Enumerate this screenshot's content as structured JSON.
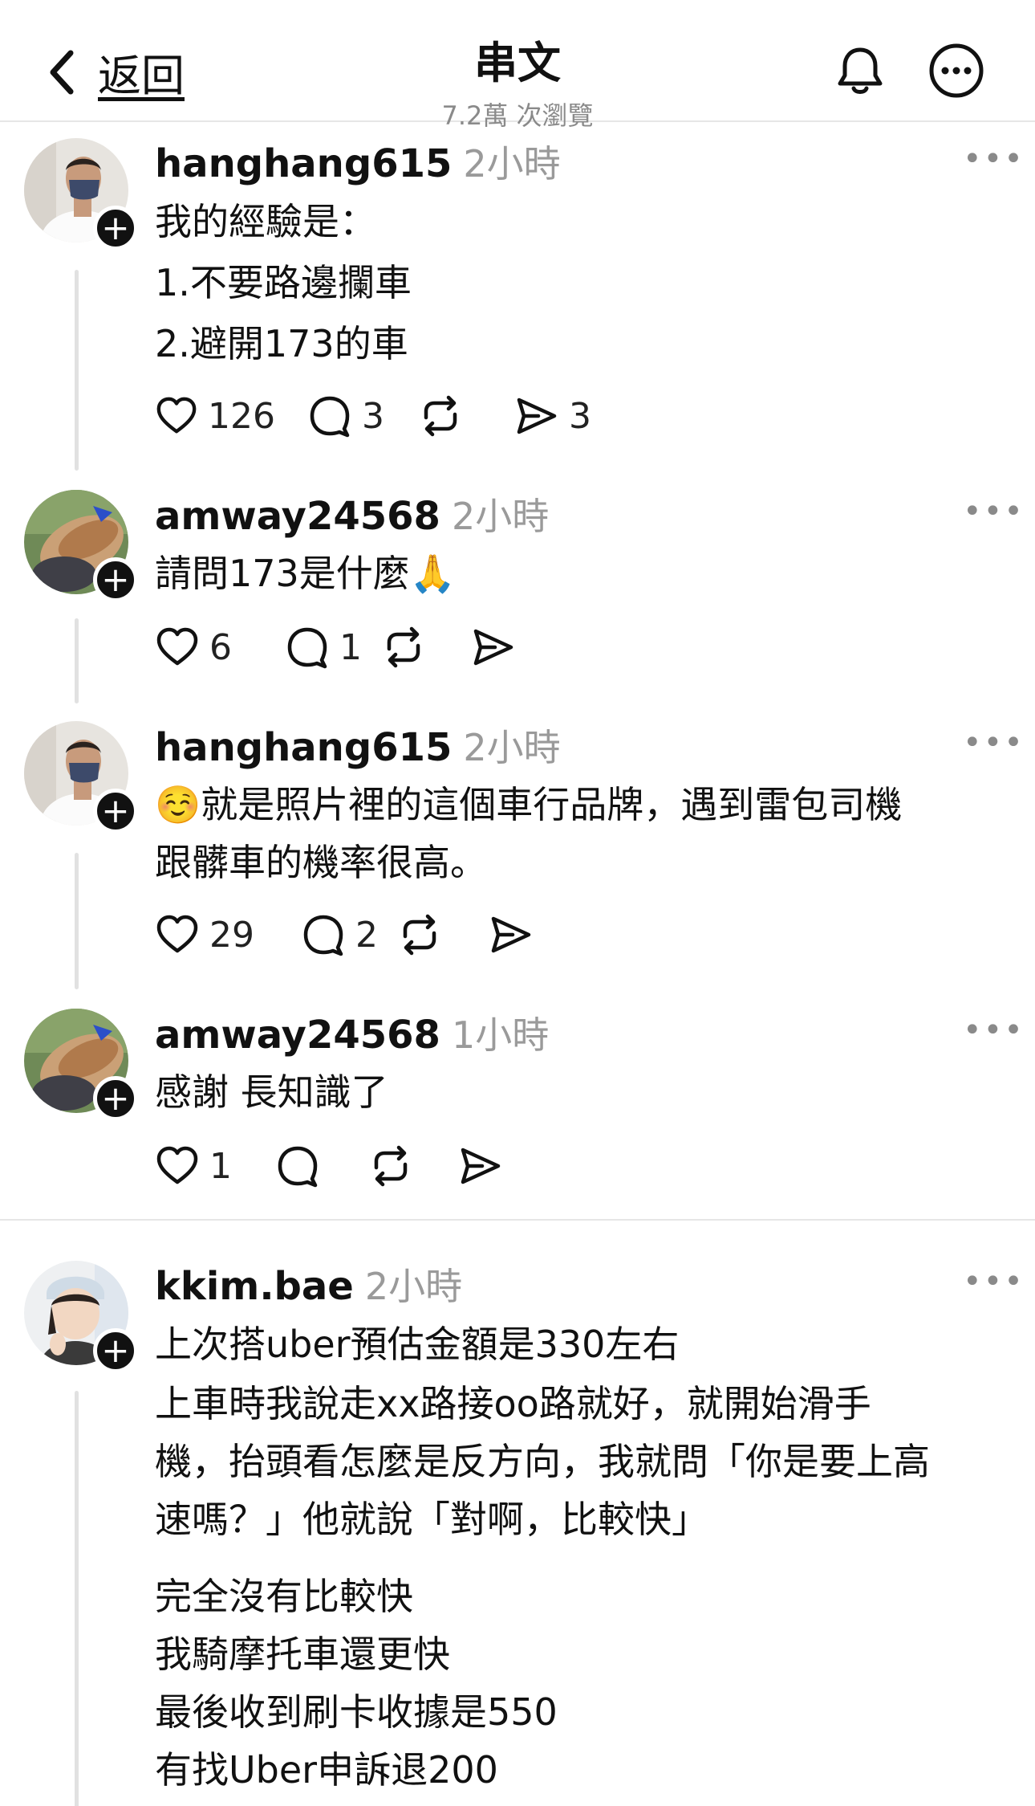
{
  "header": {
    "back_label": "返回",
    "title": "串文",
    "subtitle": "7.2萬 次瀏覽"
  },
  "posts": [
    {
      "user": "hanghang615",
      "time": "2小時",
      "lines": [
        "我的經驗是：",
        "1.不要路邊攔車",
        "2.避開173的車"
      ],
      "likes": "126",
      "comments": "3",
      "shares": "3"
    },
    {
      "user": "amway24568",
      "time": "2小時",
      "lines": [
        "請問173是什麼🙏"
      ],
      "likes": "6",
      "comments": "1",
      "shares": ""
    },
    {
      "user": "hanghang615",
      "time": "2小時",
      "lines": [
        "☺️就是照片裡的這個車行品牌，遇到雷包司機",
        "跟髒車的機率很高。"
      ],
      "likes": "29",
      "comments": "2",
      "shares": ""
    },
    {
      "user": "amway24568",
      "time": "1小時",
      "lines": [
        "感謝 長知識了"
      ],
      "likes": "1",
      "comments": "",
      "shares": ""
    },
    {
      "user": "kkim.bae",
      "time": "2小時",
      "lines": [
        "上次搭uber預估金額是330左右",
        "上車時我說走xx路接oo路就好，就開始滑手",
        "機，抬頭看怎麼是反方向，我就問「你是要上高",
        "速嗎？」他就說「對啊，比較快」",
        "完全沒有比較快",
        "我騎摩托車還更快",
        "最後收到刷卡收據是550",
        "有找Uber申訴退200"
      ]
    }
  ],
  "colors": {
    "text": "#111111",
    "muted": "#9a9a9a",
    "divider": "#e6e6e6"
  }
}
